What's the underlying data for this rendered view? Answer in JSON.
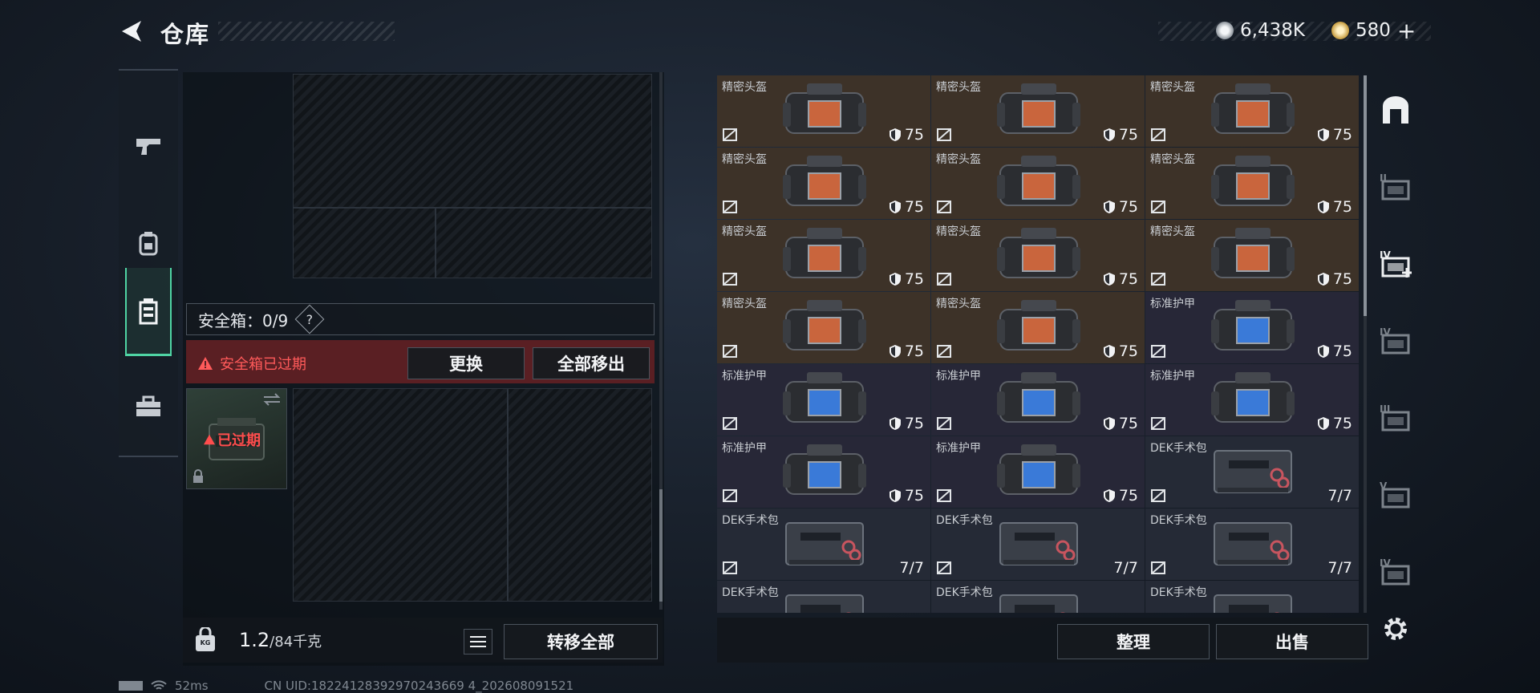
{
  "header": {
    "title": "仓库"
  },
  "currency": {
    "silver": "6,438K",
    "gold": "580",
    "gold_add": "+"
  },
  "safebox": {
    "label": "安全箱：0/9",
    "help": "?",
    "warning": "安全箱已过期",
    "replace": "更换",
    "remove_all": "全部移出",
    "slot_status": "已过期"
  },
  "footer": {
    "weight_current": "1.2",
    "weight_max": "/84千克",
    "weight_badge": "KG",
    "transfer_all": "转移全部",
    "organize": "整理",
    "sell": "出售"
  },
  "status_bar": {
    "ping": "52ms",
    "uid": "CN UID:18224128392970243669 4_202608091521"
  },
  "items": [
    {
      "name": "精密头盔",
      "value": "75",
      "kind": "helm"
    },
    {
      "name": "精密头盔",
      "value": "75",
      "kind": "helm"
    },
    {
      "name": "精密头盔",
      "value": "75",
      "kind": "helm"
    },
    {
      "name": "精密头盔",
      "value": "75",
      "kind": "helm"
    },
    {
      "name": "精密头盔",
      "value": "75",
      "kind": "helm"
    },
    {
      "name": "精密头盔",
      "value": "75",
      "kind": "helm"
    },
    {
      "name": "精密头盔",
      "value": "75",
      "kind": "helm"
    },
    {
      "name": "精密头盔",
      "value": "75",
      "kind": "helm"
    },
    {
      "name": "精密头盔",
      "value": "75",
      "kind": "helm"
    },
    {
      "name": "精密头盔",
      "value": "75",
      "kind": "helm"
    },
    {
      "name": "精密头盔",
      "value": "75",
      "kind": "helm"
    },
    {
      "name": "标准护甲",
      "value": "75",
      "kind": "armor"
    },
    {
      "name": "标准护甲",
      "value": "75",
      "kind": "armor"
    },
    {
      "name": "标准护甲",
      "value": "75",
      "kind": "armor"
    },
    {
      "name": "标准护甲",
      "value": "75",
      "kind": "armor"
    },
    {
      "name": "标准护甲",
      "value": "75",
      "kind": "armor"
    },
    {
      "name": "标准护甲",
      "value": "75",
      "kind": "armor"
    },
    {
      "name": "DEK手术包",
      "value": "7/7",
      "kind": "med"
    },
    {
      "name": "DEK手术包",
      "value": "7/7",
      "kind": "med"
    },
    {
      "name": "DEK手术包",
      "value": "7/7",
      "kind": "med"
    },
    {
      "name": "DEK手术包",
      "value": "7/7",
      "kind": "med"
    },
    {
      "name": "DEK手术包",
      "value": "",
      "kind": "med"
    },
    {
      "name": "DEK手术包",
      "value": "",
      "kind": "med"
    },
    {
      "name": "DEK手术包",
      "value": "",
      "kind": "med"
    }
  ],
  "right_tabs": [
    {
      "icon": "arch-icon"
    },
    {
      "icon": "tier2-crate-icon",
      "tier": "II"
    },
    {
      "icon": "tier4-med-icon",
      "tier": "IV"
    },
    {
      "icon": "tier4-folder-icon",
      "tier": "IV"
    },
    {
      "icon": "tier3-crate-icon",
      "tier": "III"
    },
    {
      "icon": "tier5-gear-icon",
      "tier": "V"
    },
    {
      "icon": "tier4-folder-icon",
      "tier": "IV"
    }
  ],
  "colors": {
    "accent": "#4fd4a4",
    "warning_bg": "#5a1f23",
    "warning_text": "#ff5a5a",
    "helm_bg": "#3d3228",
    "armor_bg": "#272737"
  }
}
